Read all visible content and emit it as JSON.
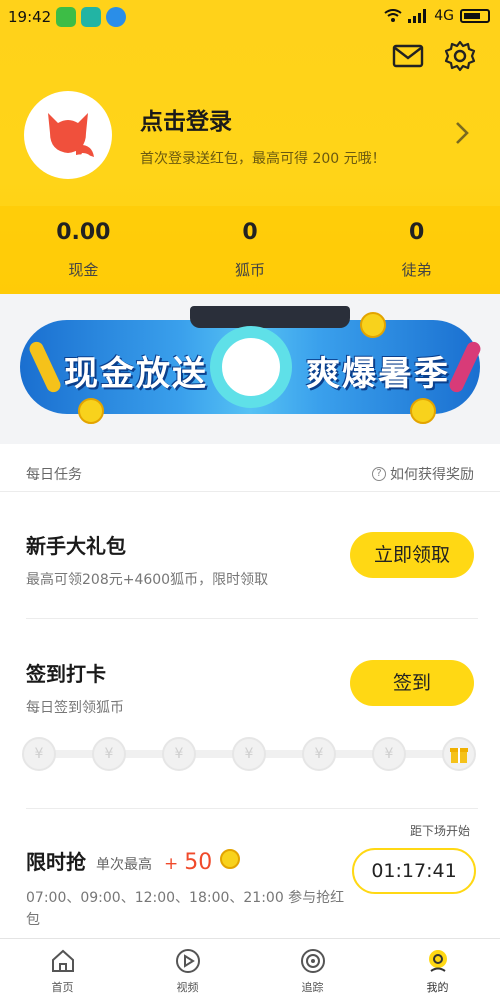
{
  "statusbar": {
    "time": "19:42",
    "network": "4G"
  },
  "profile": {
    "title": "点击登录",
    "subtitle": "首次登录送红包，最高可得 200 元哦！"
  },
  "stats": [
    {
      "value": "0.00",
      "label": "现金"
    },
    {
      "value": "0",
      "label": "狐币"
    },
    {
      "value": "0",
      "label": "徒弟"
    }
  ],
  "banner": {
    "left_text": "现金放送",
    "right_text": "爽爆暑季"
  },
  "tasks_section": {
    "title": "每日任务",
    "help": "如何获得奖励"
  },
  "newbie": {
    "title": "新手大礼包",
    "subtitle": "最高可领208元+4600狐币，限时领取",
    "button": "立即领取"
  },
  "checkin": {
    "title": "签到打卡",
    "subtitle": "每日签到领狐币",
    "button": "签到",
    "day_symbol": "¥"
  },
  "flash": {
    "title": "限时抢",
    "meta": "单次最高",
    "plus": "+",
    "amount": "50",
    "times": "07:00、09:00、12:00、18:00、21:00 参与抢红包",
    "countdown_label": "距下场开始",
    "countdown": "01:17:41"
  },
  "tabbar": [
    {
      "label": "首页",
      "icon": "home-icon"
    },
    {
      "label": "视频",
      "icon": "video-play-icon"
    },
    {
      "label": "追踪",
      "icon": "track-icon"
    },
    {
      "label": "我的",
      "icon": "profile-icon"
    }
  ],
  "colors": {
    "accent": "#ffd814",
    "highlight": "#f04a2b"
  }
}
